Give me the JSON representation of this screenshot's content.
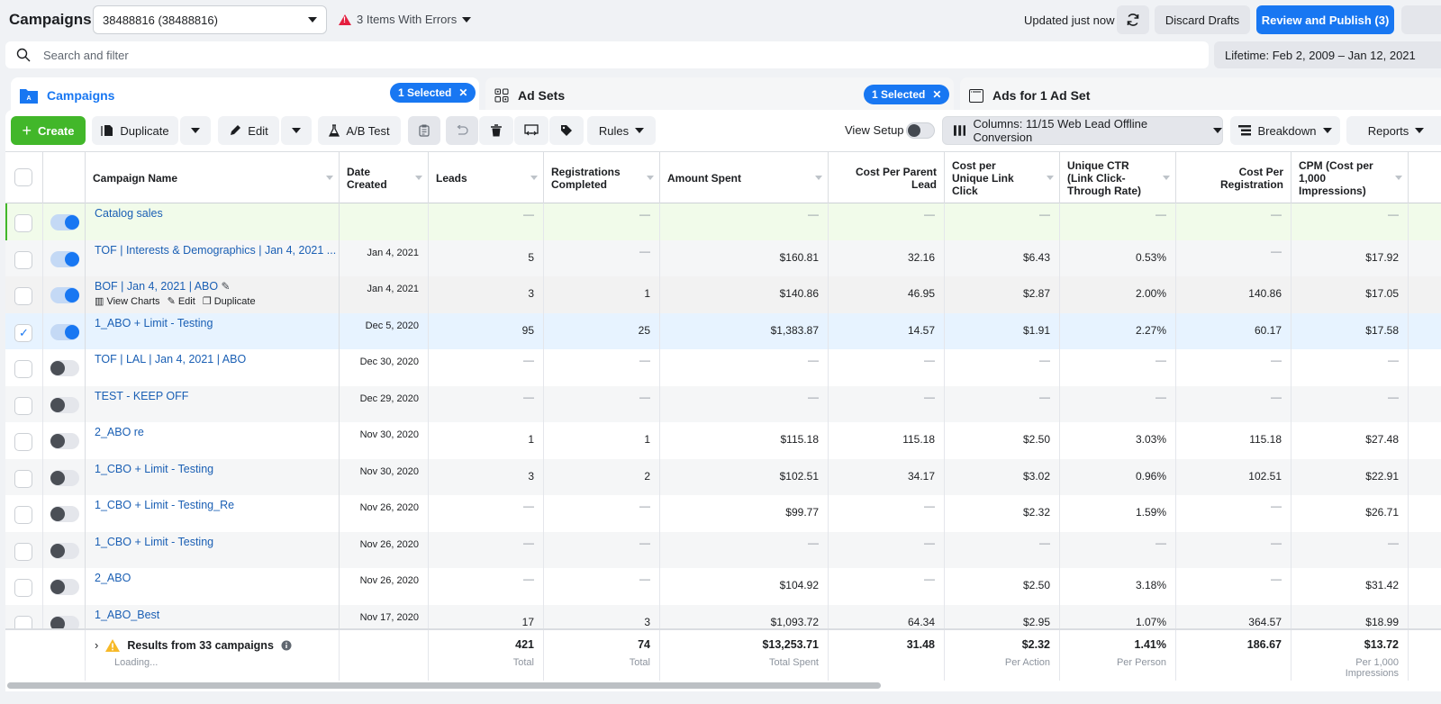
{
  "header": {
    "title": "Campaigns",
    "account": "38488816 (38488816)",
    "errors": "3 Items With Errors",
    "updated": "Updated just now",
    "discard": "Discard Drafts",
    "publish": "Review and Publish (3)"
  },
  "search": {
    "placeholder": "Search and filter",
    "value": "",
    "date_range": "Lifetime: Feb 2, 2009 – Jan 12, 2021"
  },
  "tabs": [
    {
      "label": "Campaigns",
      "selected": "1 Selected",
      "icon": "folder-icon"
    },
    {
      "label": "Ad Sets",
      "selected": "1 Selected",
      "icon": "grid-icon"
    },
    {
      "label": "Ads for 1 Ad Set",
      "icon": "ad-window-icon"
    }
  ],
  "toolbar": {
    "create": "Create",
    "duplicate": "Duplicate",
    "edit": "Edit",
    "ab_test": "A/B Test",
    "rules": "Rules",
    "view_setup": "View Setup",
    "columns": "Columns: 11/15 Web Lead Offline Conversion",
    "breakdown": "Breakdown",
    "reports": "Reports"
  },
  "table": {
    "headers": [
      "Campaign Name",
      "Date Created",
      "Leads",
      "Registrations Completed",
      "Amount Spent",
      "Cost Per Parent Lead",
      "Cost per Unique Link Click",
      "Unique CTR (Link Click-Through Rate)",
      "Cost Per Registration",
      "CPM (Cost per 1,000 Impressions)"
    ],
    "hover_actions": {
      "view_charts": "View Charts",
      "edit": "Edit",
      "duplicate": "Duplicate"
    },
    "rows": [
      {
        "name": "Catalog sales",
        "date": "",
        "leads": "—",
        "reg": "—",
        "spent": "—",
        "cppl": "—",
        "cpulc": "—",
        "uctr": "—",
        "cpr": "—",
        "cpm": "—",
        "on": true,
        "checked": false,
        "state": "new"
      },
      {
        "name": "TOF | Interests & Demographics | Jan 4, 2021 ...",
        "date": "Jan 4, 2021",
        "leads": "5",
        "reg": "—",
        "spent": "$160.81",
        "cppl": "32.16",
        "cpulc": "$6.43",
        "uctr": "0.53%",
        "cpr": "—",
        "cpm": "$17.92",
        "on": true,
        "checked": false,
        "state": "alt"
      },
      {
        "name": "BOF | Jan 4, 2021 | ABO",
        "date": "Jan 4, 2021",
        "leads": "3",
        "reg": "1",
        "spent": "$140.86",
        "cppl": "46.95",
        "cpulc": "$2.87",
        "uctr": "2.00%",
        "cpr": "140.86",
        "cpm": "$17.05",
        "on": true,
        "checked": false,
        "state": "hover"
      },
      {
        "name": "1_ABO + Limit - Testing",
        "date": "Dec 5, 2020",
        "leads": "95",
        "reg": "25",
        "spent": "$1,383.87",
        "cppl": "14.57",
        "cpulc": "$1.91",
        "uctr": "2.27%",
        "cpr": "60.17",
        "cpm": "$17.58",
        "on": true,
        "checked": true,
        "state": "selected"
      },
      {
        "name": "TOF | LAL | Jan 4, 2021 | ABO",
        "date": "Dec 30, 2020",
        "leads": "—",
        "reg": "—",
        "spent": "—",
        "cppl": "—",
        "cpulc": "—",
        "uctr": "—",
        "cpr": "—",
        "cpm": "—",
        "on": false,
        "checked": false,
        "state": "plain"
      },
      {
        "name": "TEST - KEEP OFF",
        "date": "Dec 29, 2020",
        "leads": "—",
        "reg": "—",
        "spent": "—",
        "cppl": "—",
        "cpulc": "—",
        "uctr": "—",
        "cpr": "—",
        "cpm": "—",
        "on": false,
        "checked": false,
        "state": "alt"
      },
      {
        "name": "2_ABO re",
        "date": "Nov 30, 2020",
        "leads": "1",
        "reg": "1",
        "spent": "$115.18",
        "cppl": "115.18",
        "cpulc": "$2.50",
        "uctr": "3.03%",
        "cpr": "115.18",
        "cpm": "$27.48",
        "on": false,
        "checked": false,
        "state": "plain"
      },
      {
        "name": "1_CBO + Limit - Testing",
        "date": "Nov 30, 2020",
        "leads": "3",
        "reg": "2",
        "spent": "$102.51",
        "cppl": "34.17",
        "cpulc": "$3.02",
        "uctr": "0.96%",
        "cpr": "102.51",
        "cpm": "$22.91",
        "on": false,
        "checked": false,
        "state": "alt"
      },
      {
        "name": "1_CBO + Limit - Testing_Re",
        "date": "Nov 26, 2020",
        "leads": "—",
        "reg": "—",
        "spent": "$99.77",
        "cppl": "—",
        "cpulc": "$2.32",
        "uctr": "1.59%",
        "cpr": "—",
        "cpm": "$26.71",
        "on": false,
        "checked": false,
        "state": "plain"
      },
      {
        "name": "1_CBO + Limit - Testing",
        "date": "Nov 26, 2020",
        "leads": "—",
        "reg": "—",
        "spent": "—",
        "cppl": "—",
        "cpulc": "—",
        "uctr": "—",
        "cpr": "—",
        "cpm": "—",
        "on": false,
        "checked": false,
        "state": "alt"
      },
      {
        "name": "2_ABO",
        "date": "Nov 26, 2020",
        "leads": "—",
        "reg": "—",
        "spent": "$104.92",
        "cppl": "—",
        "cpulc": "$2.50",
        "uctr": "3.18%",
        "cpr": "—",
        "cpm": "$31.42",
        "on": false,
        "checked": false,
        "state": "plain"
      },
      {
        "name": "1_ABO_Best",
        "date": "Nov 17, 2020",
        "leads": "17",
        "reg": "3",
        "spent": "$1,093.72",
        "cppl": "64.34",
        "cpulc": "$2.95",
        "uctr": "1.07%",
        "cpr": "364.57",
        "cpm": "$18.99",
        "on": false,
        "checked": false,
        "state": "alt"
      }
    ],
    "footer": {
      "label": "Results from 33 campaigns",
      "loading": "Loading...",
      "leads": {
        "value": "421",
        "sub": "Total"
      },
      "reg": {
        "value": "74",
        "sub": "Total"
      },
      "spent": {
        "value": "$13,253.71",
        "sub": "Total Spent"
      },
      "cppl": {
        "value": "31.48",
        "sub": ""
      },
      "cpulc": {
        "value": "$2.32",
        "sub": "Per Action"
      },
      "uctr": {
        "value": "1.41%",
        "sub": "Per Person"
      },
      "cpr": {
        "value": "186.67",
        "sub": ""
      },
      "cpm": {
        "value": "$13.72",
        "sub": "Per 1,000 Impressions"
      }
    }
  },
  "colors": {
    "primary": "#1877f2",
    "create": "#42b72a",
    "error": "#e41e3f",
    "warning": "#f7b928",
    "row_new": "#f1fbea",
    "row_selected": "#e7f3ff",
    "link": "#1a5fb4"
  }
}
